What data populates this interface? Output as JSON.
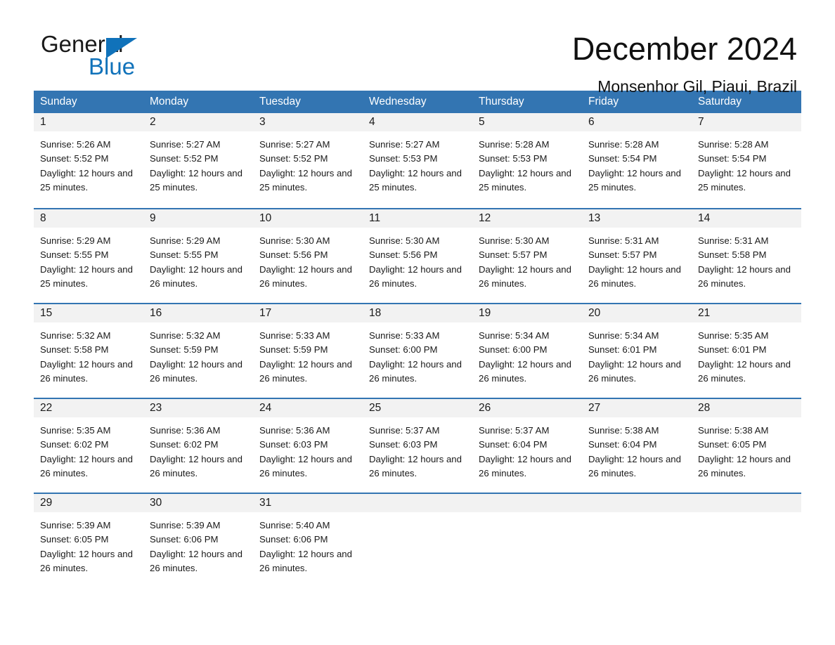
{
  "brand": {
    "name_part1": "General",
    "name_part2": "Blue",
    "accent_color": "#1072BA"
  },
  "header": {
    "month_title": "December 2024",
    "location": "Monsenhor Gil, Piaui, Brazil",
    "header_bg_color": "#3375B2",
    "day_band_color": "#F2F2F2"
  },
  "weekdays": [
    "Sunday",
    "Monday",
    "Tuesday",
    "Wednesday",
    "Thursday",
    "Friday",
    "Saturday"
  ],
  "weeks": [
    [
      {
        "day": "1",
        "sunrise": "Sunrise: 5:26 AM",
        "sunset": "Sunset: 5:52 PM",
        "daylight": "Daylight: 12 hours and 25 minutes."
      },
      {
        "day": "2",
        "sunrise": "Sunrise: 5:27 AM",
        "sunset": "Sunset: 5:52 PM",
        "daylight": "Daylight: 12 hours and 25 minutes."
      },
      {
        "day": "3",
        "sunrise": "Sunrise: 5:27 AM",
        "sunset": "Sunset: 5:52 PM",
        "daylight": "Daylight: 12 hours and 25 minutes."
      },
      {
        "day": "4",
        "sunrise": "Sunrise: 5:27 AM",
        "sunset": "Sunset: 5:53 PM",
        "daylight": "Daylight: 12 hours and 25 minutes."
      },
      {
        "day": "5",
        "sunrise": "Sunrise: 5:28 AM",
        "sunset": "Sunset: 5:53 PM",
        "daylight": "Daylight: 12 hours and 25 minutes."
      },
      {
        "day": "6",
        "sunrise": "Sunrise: 5:28 AM",
        "sunset": "Sunset: 5:54 PM",
        "daylight": "Daylight: 12 hours and 25 minutes."
      },
      {
        "day": "7",
        "sunrise": "Sunrise: 5:28 AM",
        "sunset": "Sunset: 5:54 PM",
        "daylight": "Daylight: 12 hours and 25 minutes."
      }
    ],
    [
      {
        "day": "8",
        "sunrise": "Sunrise: 5:29 AM",
        "sunset": "Sunset: 5:55 PM",
        "daylight": "Daylight: 12 hours and 25 minutes."
      },
      {
        "day": "9",
        "sunrise": "Sunrise: 5:29 AM",
        "sunset": "Sunset: 5:55 PM",
        "daylight": "Daylight: 12 hours and 26 minutes."
      },
      {
        "day": "10",
        "sunrise": "Sunrise: 5:30 AM",
        "sunset": "Sunset: 5:56 PM",
        "daylight": "Daylight: 12 hours and 26 minutes."
      },
      {
        "day": "11",
        "sunrise": "Sunrise: 5:30 AM",
        "sunset": "Sunset: 5:56 PM",
        "daylight": "Daylight: 12 hours and 26 minutes."
      },
      {
        "day": "12",
        "sunrise": "Sunrise: 5:30 AM",
        "sunset": "Sunset: 5:57 PM",
        "daylight": "Daylight: 12 hours and 26 minutes."
      },
      {
        "day": "13",
        "sunrise": "Sunrise: 5:31 AM",
        "sunset": "Sunset: 5:57 PM",
        "daylight": "Daylight: 12 hours and 26 minutes."
      },
      {
        "day": "14",
        "sunrise": "Sunrise: 5:31 AM",
        "sunset": "Sunset: 5:58 PM",
        "daylight": "Daylight: 12 hours and 26 minutes."
      }
    ],
    [
      {
        "day": "15",
        "sunrise": "Sunrise: 5:32 AM",
        "sunset": "Sunset: 5:58 PM",
        "daylight": "Daylight: 12 hours and 26 minutes."
      },
      {
        "day": "16",
        "sunrise": "Sunrise: 5:32 AM",
        "sunset": "Sunset: 5:59 PM",
        "daylight": "Daylight: 12 hours and 26 minutes."
      },
      {
        "day": "17",
        "sunrise": "Sunrise: 5:33 AM",
        "sunset": "Sunset: 5:59 PM",
        "daylight": "Daylight: 12 hours and 26 minutes."
      },
      {
        "day": "18",
        "sunrise": "Sunrise: 5:33 AM",
        "sunset": "Sunset: 6:00 PM",
        "daylight": "Daylight: 12 hours and 26 minutes."
      },
      {
        "day": "19",
        "sunrise": "Sunrise: 5:34 AM",
        "sunset": "Sunset: 6:00 PM",
        "daylight": "Daylight: 12 hours and 26 minutes."
      },
      {
        "day": "20",
        "sunrise": "Sunrise: 5:34 AM",
        "sunset": "Sunset: 6:01 PM",
        "daylight": "Daylight: 12 hours and 26 minutes."
      },
      {
        "day": "21",
        "sunrise": "Sunrise: 5:35 AM",
        "sunset": "Sunset: 6:01 PM",
        "daylight": "Daylight: 12 hours and 26 minutes."
      }
    ],
    [
      {
        "day": "22",
        "sunrise": "Sunrise: 5:35 AM",
        "sunset": "Sunset: 6:02 PM",
        "daylight": "Daylight: 12 hours and 26 minutes."
      },
      {
        "day": "23",
        "sunrise": "Sunrise: 5:36 AM",
        "sunset": "Sunset: 6:02 PM",
        "daylight": "Daylight: 12 hours and 26 minutes."
      },
      {
        "day": "24",
        "sunrise": "Sunrise: 5:36 AM",
        "sunset": "Sunset: 6:03 PM",
        "daylight": "Daylight: 12 hours and 26 minutes."
      },
      {
        "day": "25",
        "sunrise": "Sunrise: 5:37 AM",
        "sunset": "Sunset: 6:03 PM",
        "daylight": "Daylight: 12 hours and 26 minutes."
      },
      {
        "day": "26",
        "sunrise": "Sunrise: 5:37 AM",
        "sunset": "Sunset: 6:04 PM",
        "daylight": "Daylight: 12 hours and 26 minutes."
      },
      {
        "day": "27",
        "sunrise": "Sunrise: 5:38 AM",
        "sunset": "Sunset: 6:04 PM",
        "daylight": "Daylight: 12 hours and 26 minutes."
      },
      {
        "day": "28",
        "sunrise": "Sunrise: 5:38 AM",
        "sunset": "Sunset: 6:05 PM",
        "daylight": "Daylight: 12 hours and 26 minutes."
      }
    ],
    [
      {
        "day": "29",
        "sunrise": "Sunrise: 5:39 AM",
        "sunset": "Sunset: 6:05 PM",
        "daylight": "Daylight: 12 hours and 26 minutes."
      },
      {
        "day": "30",
        "sunrise": "Sunrise: 5:39 AM",
        "sunset": "Sunset: 6:06 PM",
        "daylight": "Daylight: 12 hours and 26 minutes."
      },
      {
        "day": "31",
        "sunrise": "Sunrise: 5:40 AM",
        "sunset": "Sunset: 6:06 PM",
        "daylight": "Daylight: 12 hours and 26 minutes."
      },
      {
        "day": "",
        "sunrise": "",
        "sunset": "",
        "daylight": ""
      },
      {
        "day": "",
        "sunrise": "",
        "sunset": "",
        "daylight": ""
      },
      {
        "day": "",
        "sunrise": "",
        "sunset": "",
        "daylight": ""
      },
      {
        "day": "",
        "sunrise": "",
        "sunset": "",
        "daylight": ""
      }
    ]
  ]
}
